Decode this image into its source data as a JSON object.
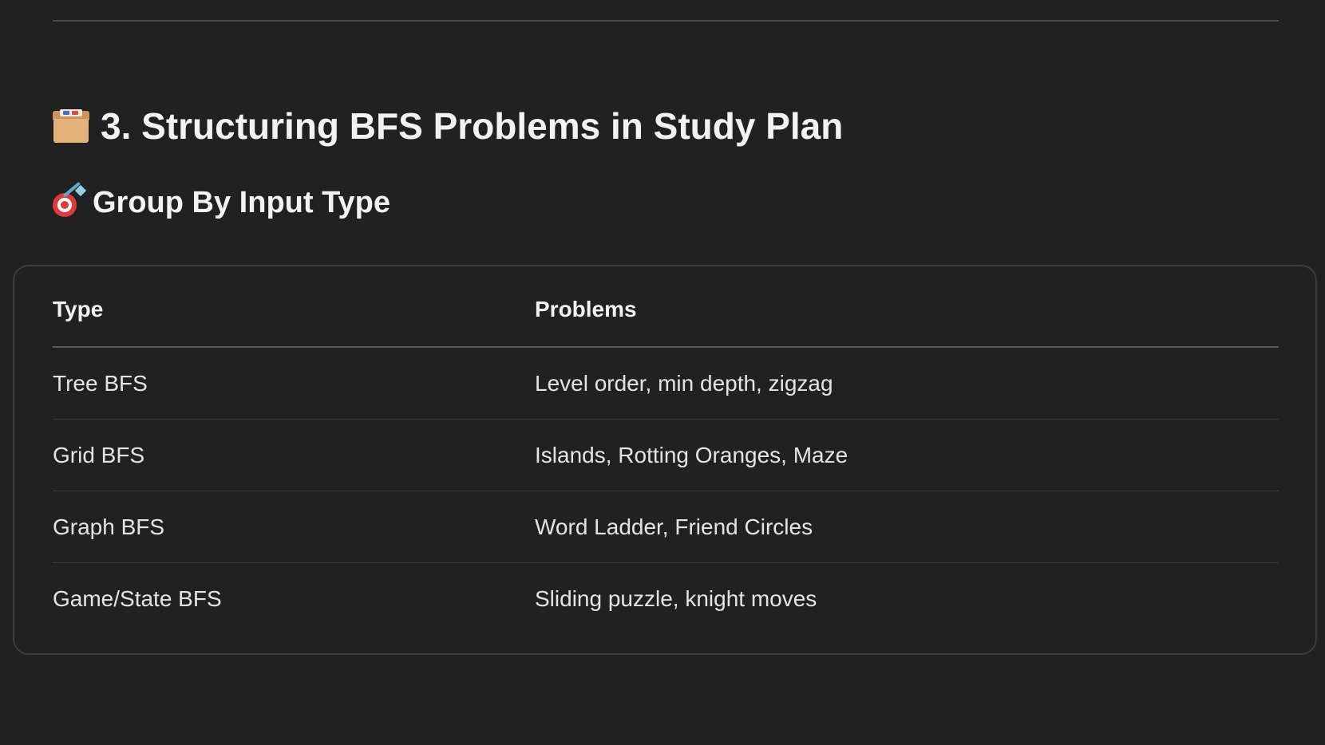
{
  "heading": {
    "icon": "card-file-box-icon",
    "text": "3. Structuring BFS Problems in Study Plan"
  },
  "subheading": {
    "icon": "direct-hit-icon",
    "text": "Group By Input Type"
  },
  "table": {
    "headers": [
      "Type",
      "Problems"
    ],
    "rows": [
      {
        "type": "Tree BFS",
        "problems": "Level order, min depth, zigzag"
      },
      {
        "type": "Grid BFS",
        "problems": "Islands, Rotting Oranges, Maze"
      },
      {
        "type": "Graph BFS",
        "problems": "Word Ladder, Friend Circles"
      },
      {
        "type": "Game/State BFS",
        "problems": "Sliding puzzle, knight moves"
      }
    ]
  }
}
